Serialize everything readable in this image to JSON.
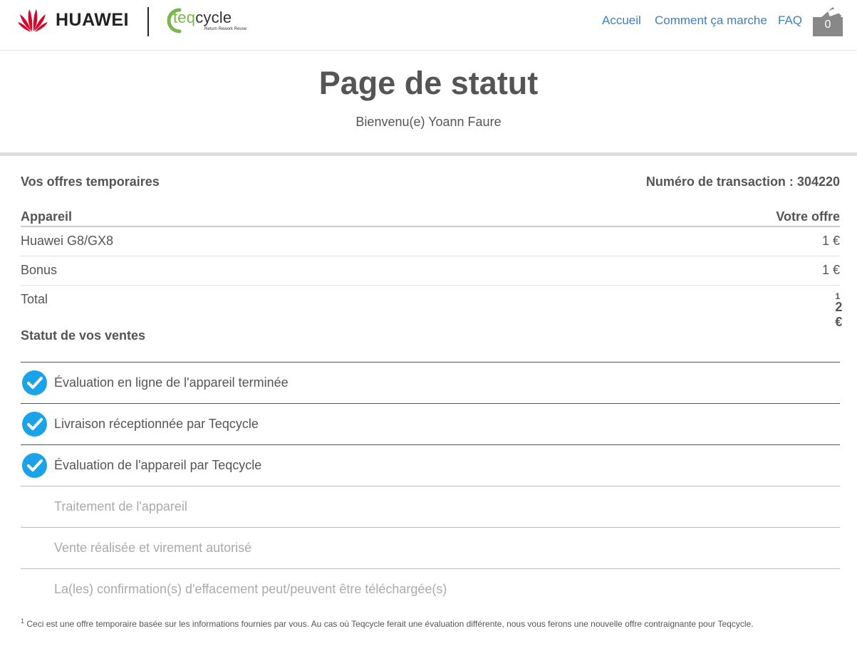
{
  "header": {
    "huawei_brand": "HUAWEI",
    "teq_brand_prefix": "teq",
    "teq_brand_suffix": "cycle",
    "teq_tagline": "Return Rework Reuse",
    "nav": [
      {
        "label": "Accueil"
      },
      {
        "label": "Comment ça marche"
      },
      {
        "label": "FAQ"
      }
    ],
    "cart_count": "0",
    "cart_icon": "cart-bag-icon"
  },
  "title_band": {
    "title": "Page de statut",
    "welcome": "Bienvenu(e) Yoann Faure"
  },
  "offers": {
    "heading": "Vos offres temporaires",
    "transaction_label": "Numéro de transaction : 304220",
    "columns": {
      "device": "Appareil",
      "offer": "Votre offre"
    },
    "rows": [
      {
        "label": "Huawei G8/GX8",
        "value": "1 €"
      },
      {
        "label": "Bonus",
        "value": "1 €"
      }
    ],
    "total": {
      "label": "Total",
      "value": "2 €",
      "footnote_mark": "1"
    }
  },
  "status": {
    "heading": "Statut de vos ventes",
    "steps": [
      {
        "label": "Évaluation en ligne de l'appareil terminée",
        "done": true
      },
      {
        "label": "Livraison réceptionnée par Teqcycle",
        "done": true
      },
      {
        "label": "Évaluation de l'appareil par Teqcycle",
        "done": true
      },
      {
        "label": "Traitement de l'appareil",
        "done": false
      },
      {
        "label": "Vente réalisée et virement autorisé",
        "done": false
      },
      {
        "label": "La(les) confirmation(s) d'effacement peut/peuvent être téléchargée(s)",
        "done": false
      }
    ],
    "check_icon": "check-circle-icon"
  },
  "footnote": {
    "mark": "1",
    "text": "Ceci est une offre temporaire basée sur les informations fournies par vous. Au cas où Teqcycle ferait une évaluation différente, nous vous ferons une nouvelle offre contraignante pour Teqcycle."
  },
  "colors": {
    "link": "#3d7fc1",
    "check": "#1aa3e8",
    "huawei_red": "#cf0a2c",
    "teq_green": "#7ab648"
  }
}
